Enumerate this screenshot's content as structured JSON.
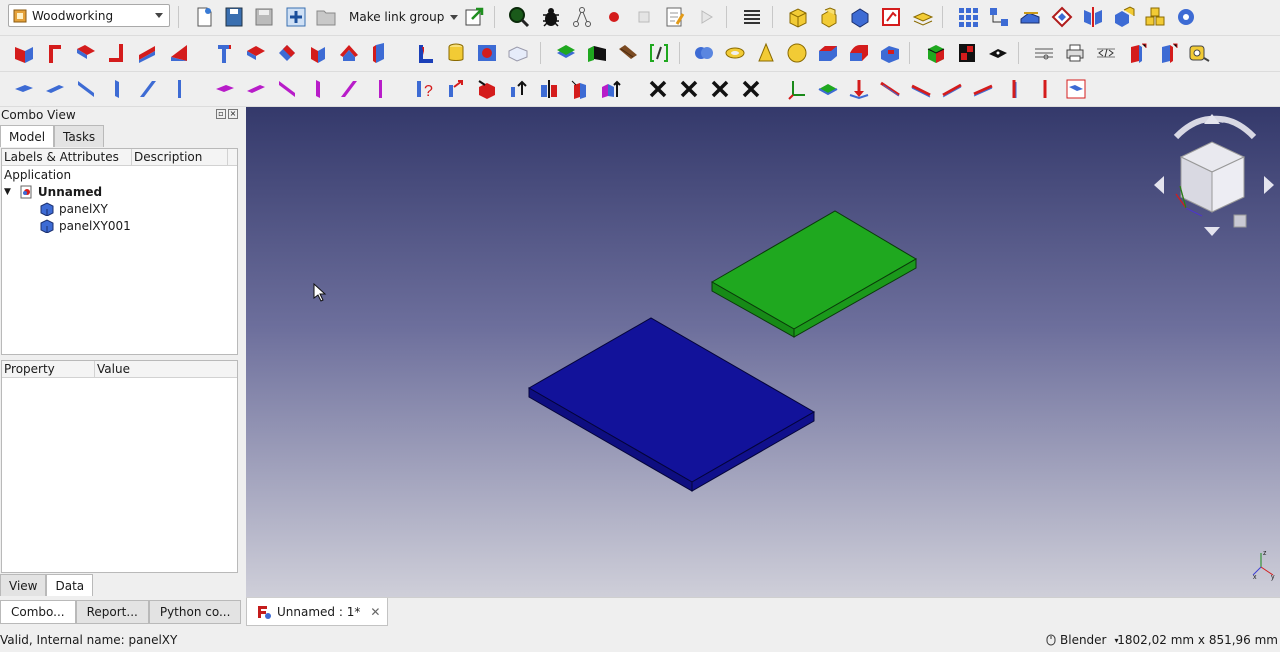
{
  "toolbar": {
    "workbench": "Woodworking",
    "make_link_group": "Make link group"
  },
  "combo": {
    "title": "Combo View",
    "tabs": [
      "Model",
      "Tasks"
    ],
    "tree_headers": [
      "Labels & Attributes",
      "Description"
    ],
    "application_label": "Application",
    "document_name": "Unnamed",
    "objects": [
      "panelXY",
      "panelXY001"
    ],
    "property_headers": [
      "Property",
      "Value"
    ],
    "view_tabs": [
      "View",
      "Data"
    ]
  },
  "bottom_tabs": [
    "Combo...",
    "Report...",
    "Python co..."
  ],
  "doc_tab": {
    "label": "Unnamed : 1*"
  },
  "status": {
    "message": "Valid, Internal name: panelXY",
    "navigation": "Blender",
    "dimensions": "1802,02 mm x 851,96 mm"
  },
  "colors": {
    "green_panel": "#1fa81f",
    "blue_panel": "#12129a",
    "bg_top": "#34396b",
    "bg_bottom": "#cfcfd9"
  }
}
